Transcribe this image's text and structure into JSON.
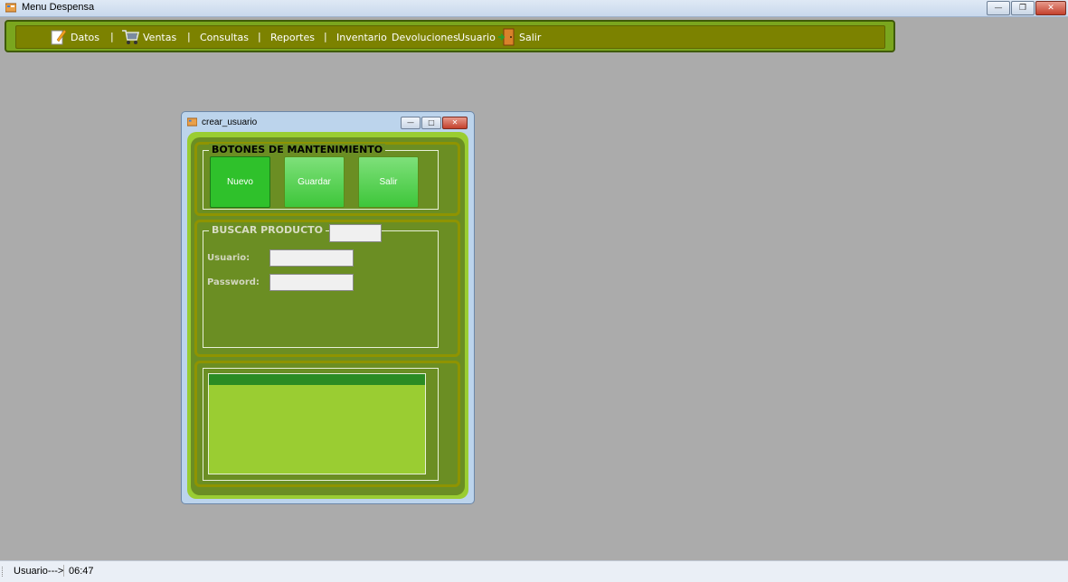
{
  "window": {
    "title": "Menu Despensa",
    "controls": [
      "minimize",
      "restore",
      "close"
    ]
  },
  "menu": {
    "items": [
      {
        "label": "Datos",
        "icon": "notepad-icon"
      },
      {
        "label": "Ventas",
        "icon": "cart-icon"
      },
      {
        "label": "Consultas"
      },
      {
        "label": "Reportes"
      },
      {
        "label": "Inventario"
      },
      {
        "label": "Devoluciones"
      },
      {
        "label": "Usuario"
      },
      {
        "label": "Salir",
        "icon": "exit-door-icon"
      }
    ],
    "separator": "|"
  },
  "child_window": {
    "title": "crear_usuario",
    "maintenance": {
      "legend": "BOTONES DE MANTENIMIENTO",
      "buttons": {
        "nuevo": "Nuevo",
        "guardar": "Guardar",
        "salir": "Salir"
      }
    },
    "search": {
      "legend": "BUSCAR PRODUCTO",
      "search_value": "",
      "usuario_label": "Usuario:",
      "usuario_value": "",
      "password_label": "Password:",
      "password_value": ""
    }
  },
  "status": {
    "user_text": "Usuario--->",
    "time": "06:47"
  },
  "colors": {
    "desktop": "#ababab",
    "menu_background": "#7c8200",
    "panel_green": "#6b8e23",
    "light_green": "#9acd32",
    "button_green": "#3ec63a",
    "grid_header": "#2b8b23"
  }
}
